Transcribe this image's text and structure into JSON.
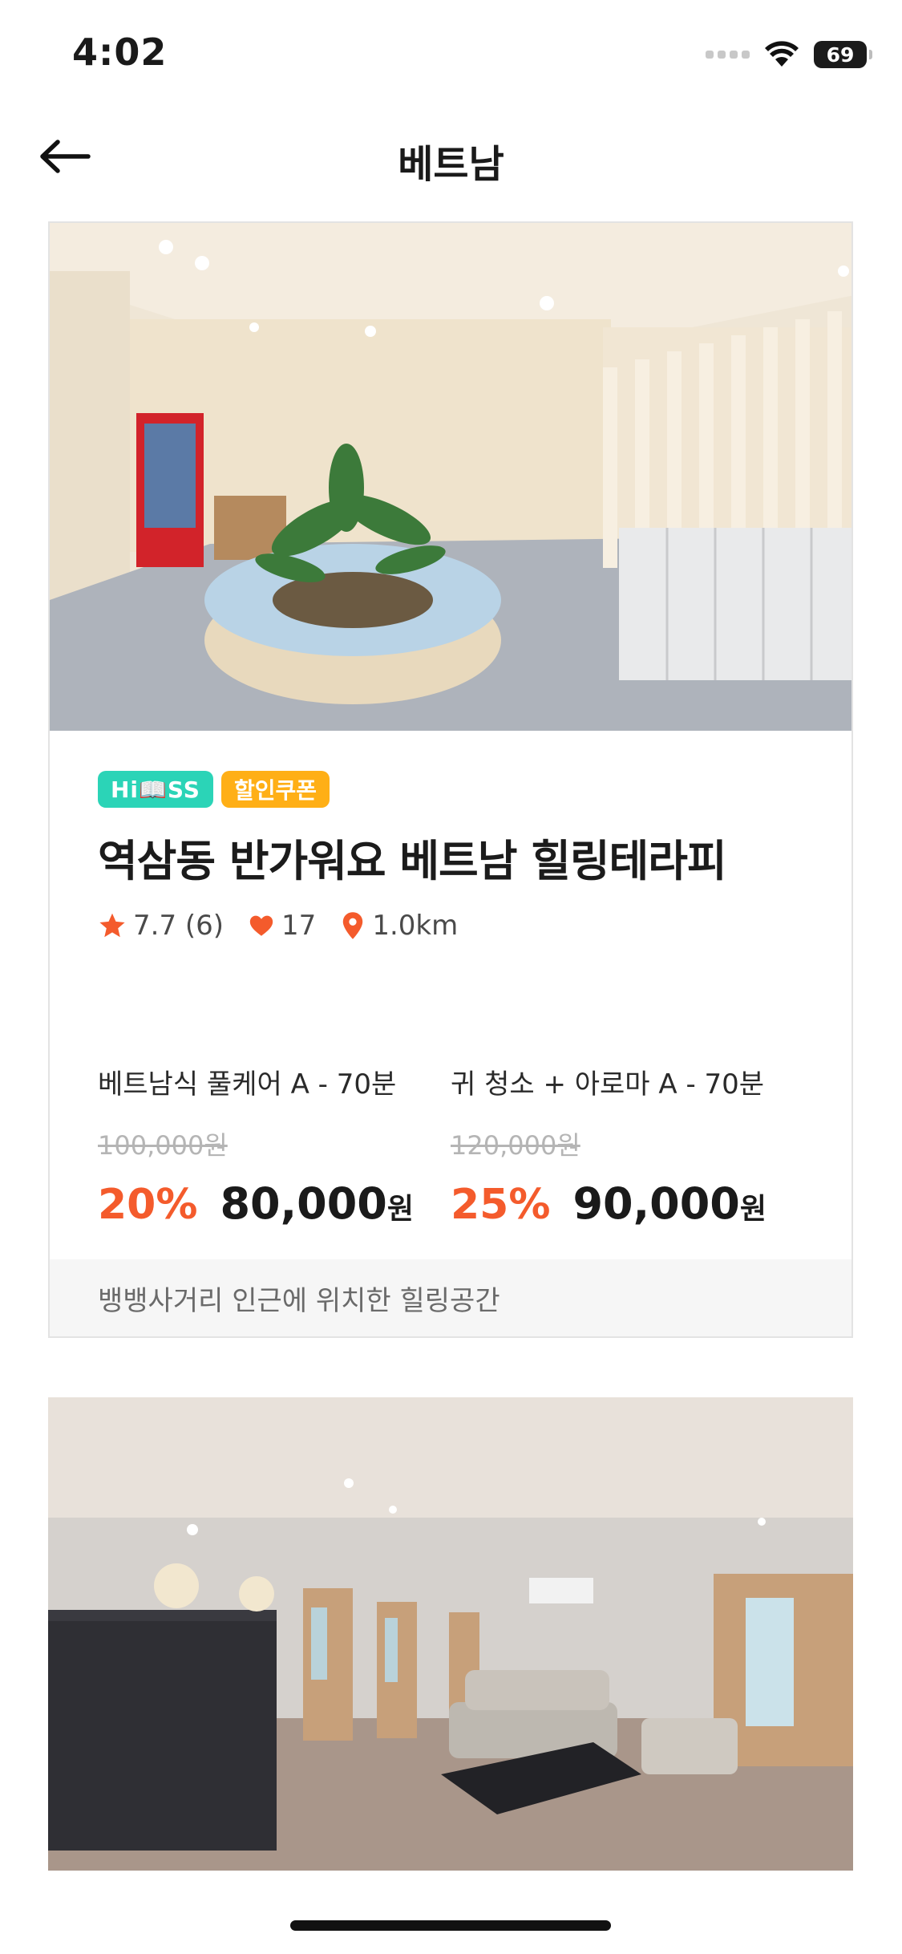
{
  "status": {
    "time": "4:02",
    "battery": "69"
  },
  "nav": {
    "title": "베트남"
  },
  "listing": {
    "badges": {
      "hipass": "Hi📖SS",
      "coupon": "할인쿠폰"
    },
    "name": "역삼동 반가워요 베트남 힐링테라피",
    "rating": "7.7 (6)",
    "likes": "17",
    "distance": "1.0km",
    "offers": [
      {
        "name": "베트남식 풀케어 A - 70분",
        "original": "100,000원",
        "discount": "20%",
        "price": "80,000",
        "unit": "원"
      },
      {
        "name": "귀 청소 + 아로마 A - 70분",
        "original": "120,000원",
        "discount": "25%",
        "price": "90,000",
        "unit": "원"
      }
    ],
    "description": "뱅뱅사거리 인근에 위치한 힐링공간"
  },
  "colors": {
    "accent": "#f45b2c",
    "hipass": "#2bd4b7",
    "coupon": "#ffaf16"
  },
  "icons": [
    "back-arrow-icon",
    "wifi-icon",
    "star-icon",
    "heart-icon",
    "location-pin-icon"
  ]
}
